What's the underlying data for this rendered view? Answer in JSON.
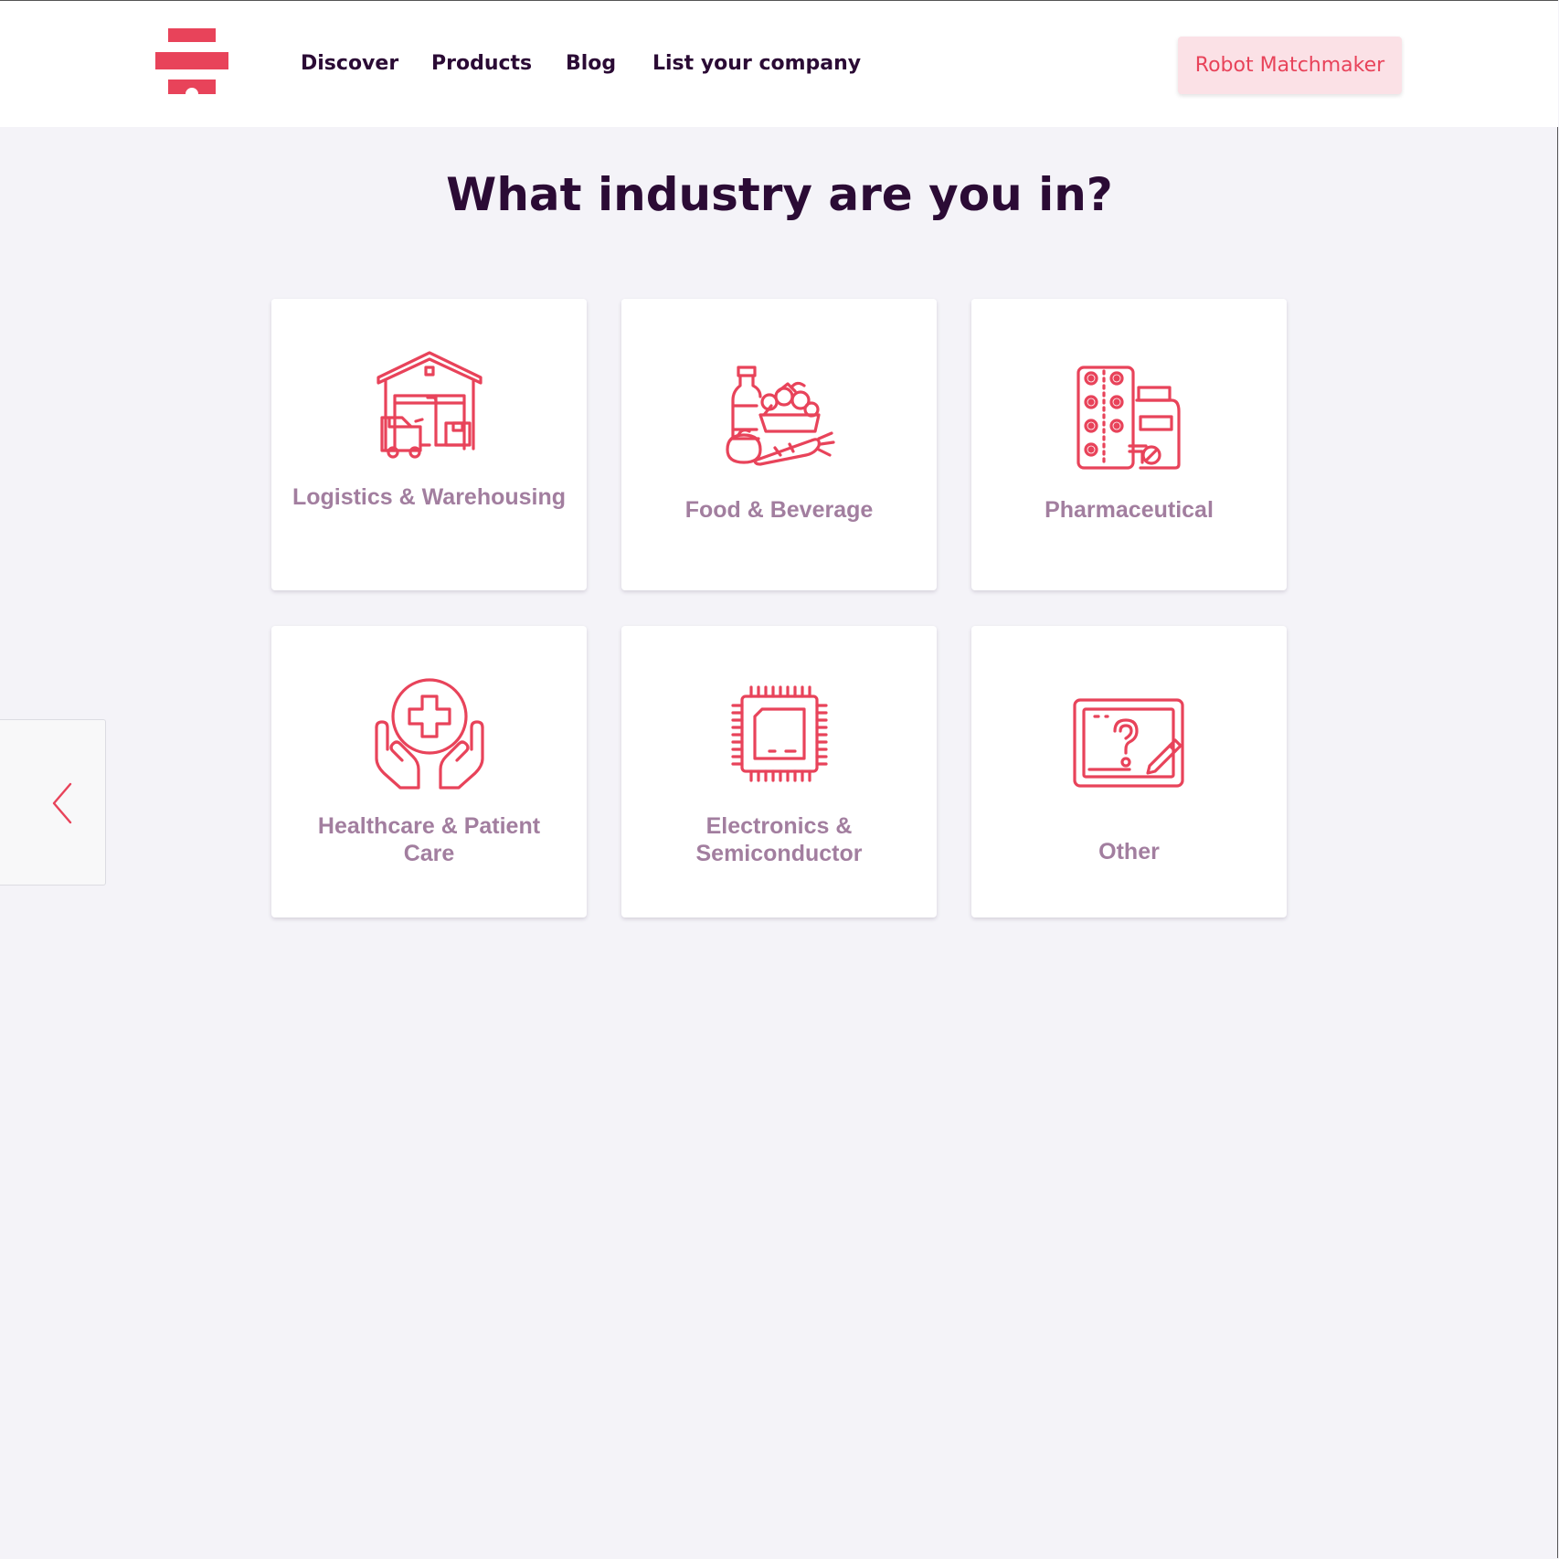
{
  "brand": {
    "accent_color": "#e8435a",
    "text_color": "#2b0b35",
    "label_color": "#a27e9f"
  },
  "header": {
    "logo_icon": "logo-stacked-bars-icon",
    "nav": [
      "Discover",
      "Products",
      "Blog",
      "List your company"
    ],
    "cta_label": "Robot Matchmaker"
  },
  "main": {
    "title": "What industry are you in?",
    "cards": [
      {
        "icon": "warehouse-forklift-icon",
        "label": "Logistics & Warehousing"
      },
      {
        "icon": "groceries-icon",
        "label": "Food & Beverage"
      },
      {
        "icon": "pills-bottle-icon",
        "label": "Pharmaceutical"
      },
      {
        "icon": "hands-medical-cross-icon",
        "label": "Healthcare & Patient Care"
      },
      {
        "icon": "microchip-icon",
        "label": "Electronics & Semiconductor"
      },
      {
        "icon": "question-tablet-icon",
        "label": "Other"
      }
    ]
  },
  "back_button": {
    "icon": "chevron-left-icon"
  }
}
